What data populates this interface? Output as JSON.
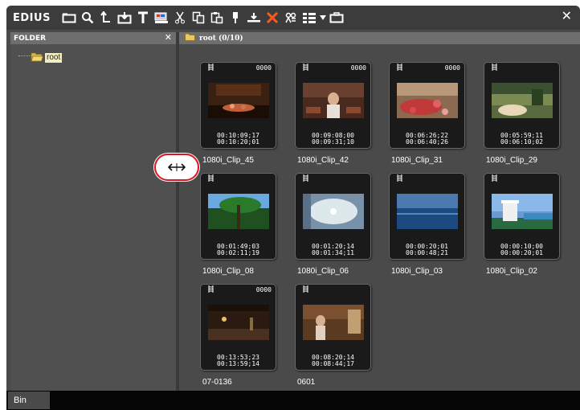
{
  "app": {
    "logo": "EDIUS",
    "close_glyph": "✕"
  },
  "toolbar": {
    "icons": [
      "new-folder-icon",
      "search-icon",
      "up-icon",
      "import-icon",
      "title-icon",
      "edit-icon",
      "cut-icon",
      "copy-icon",
      "paste-icon",
      "add-to-player-icon",
      "add-to-timeline-icon",
      "delete-icon",
      "properties-icon",
      "view-icon",
      "dropdown-icon",
      "save-icon"
    ]
  },
  "folder_panel": {
    "title": "FOLDER",
    "close_glyph": "✕",
    "root_label": "root"
  },
  "bin_panel": {
    "path": "root (0/10)"
  },
  "clips": [
    {
      "name": "1080i_Clip_45",
      "counter": "0000",
      "tc_in": "00:10:09;17",
      "tc_out": "00:10:20;01",
      "scene": "dinner"
    },
    {
      "name": "1080i_Clip_42",
      "counter": "0000",
      "tc_in": "00:09:08;00",
      "tc_out": "00:09:31;10",
      "scene": "woman"
    },
    {
      "name": "1080i_Clip_31",
      "counter": "0000",
      "tc_in": "00:06:26;22",
      "tc_out": "00:06:40;26",
      "scene": "flowers"
    },
    {
      "name": "1080i_Clip_29",
      "counter": "",
      "tc_in": "00:05:59;11",
      "tc_out": "00:06:10;02",
      "scene": "garden"
    },
    {
      "name": "1080i_Clip_08",
      "counter": "",
      "tc_in": "00:01:49;03",
      "tc_out": "00:02:11;19",
      "scene": "palms"
    },
    {
      "name": "1080i_Clip_06",
      "counter": "",
      "tc_in": "00:01:20;14",
      "tc_out": "00:01:34;11",
      "scene": "ceiling"
    },
    {
      "name": "1080i_Clip_03",
      "counter": "",
      "tc_in": "00:00:20;01",
      "tc_out": "00:00:48;21",
      "scene": "sea"
    },
    {
      "name": "1080i_Clip_02",
      "counter": "",
      "tc_in": "00:00:10;00",
      "tc_out": "00:00:20;01",
      "scene": "pavilion"
    },
    {
      "name": "07-0136",
      "counter": "0000",
      "tc_in": "00:13:53;23",
      "tc_out": "00:13:59;14",
      "scene": "candle"
    },
    {
      "name": "0601",
      "counter": "",
      "tc_in": "00:08:20;14",
      "tc_out": "00:08:44;17",
      "scene": "room"
    }
  ],
  "tabs": {
    "bin": "Bin"
  },
  "annotation": {
    "cursor_icon": "resize-horizontal-icon",
    "color": "#d9161e"
  }
}
